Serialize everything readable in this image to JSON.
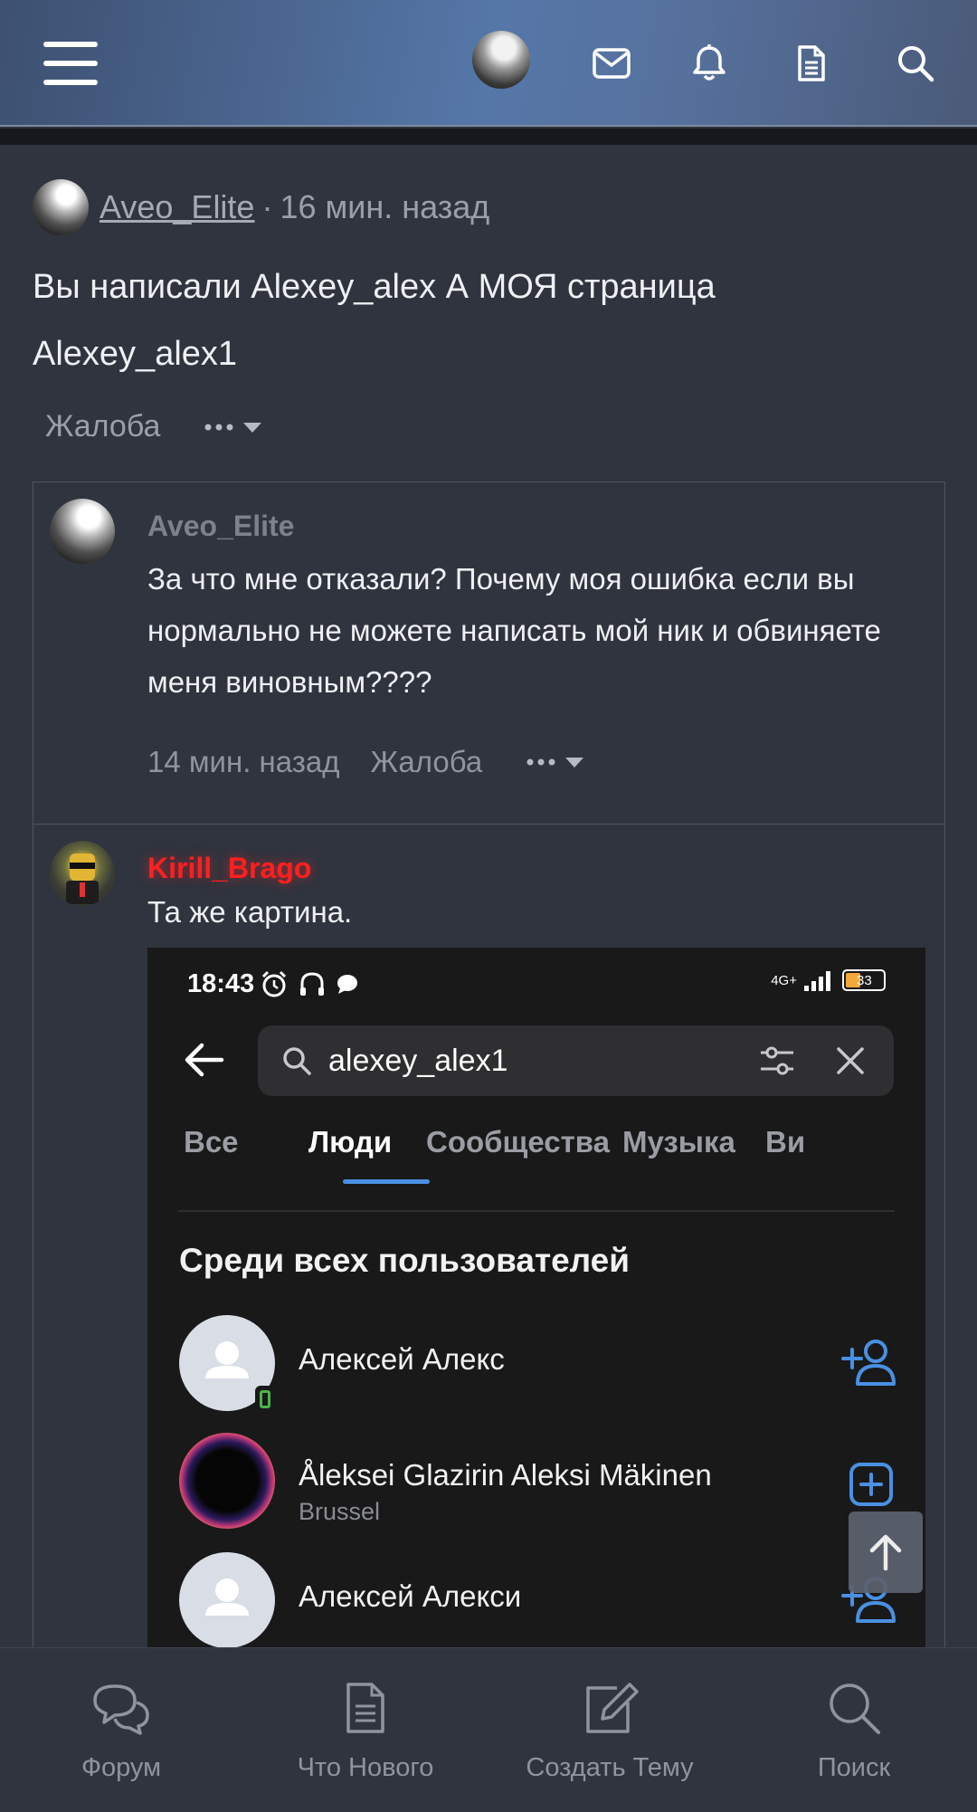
{
  "header": {
    "menu_icon": "hamburger-menu-icon",
    "icons": [
      "avatar",
      "envelope-icon",
      "bell-icon",
      "document-icon",
      "search-icon"
    ]
  },
  "post": {
    "author": "Aveo_Elite",
    "separator": "·",
    "time": "16 мин. назад",
    "body_line1": "Вы написали Alexey_alex А МОЯ страница",
    "body_line2": "Alexey_alex1",
    "report": "Жалоба"
  },
  "quote1": {
    "author": "Aveo_Elite",
    "text": "За что мне отказали? Почему моя ошибка если вы нормально не можете написать мой ник и обвиняете меня виновным????",
    "time": "14 мин. назад",
    "report": "Жалоба"
  },
  "quote2": {
    "author": "Kirill_Brago",
    "author_color": "#ff1f1f",
    "text": "Та же картина."
  },
  "screenshot": {
    "status_time": "18:43",
    "network": "4G+",
    "battery": "33",
    "search_query": "alexey_alex1",
    "tabs": [
      "Все",
      "Люди",
      "Сообщества",
      "Музыка",
      "Ви"
    ],
    "active_tab": "Люди",
    "section_title": "Среди всех пользователей",
    "people": [
      {
        "name": "Алексей Алекс",
        "sub": ""
      },
      {
        "name": "Åleksei Glazirin Aleksi Mäkinen",
        "sub": "Brussel"
      },
      {
        "name": "Алексей Алекси",
        "sub": ""
      }
    ],
    "accent": "#4a90e2"
  },
  "bottom_nav": [
    {
      "label": "Форум",
      "icon": "chat-bubbles-icon"
    },
    {
      "label": "Что Нового",
      "icon": "document-icon"
    },
    {
      "label": "Создать Тему",
      "icon": "edit-icon"
    },
    {
      "label": "Поиск",
      "icon": "search-icon"
    }
  ]
}
